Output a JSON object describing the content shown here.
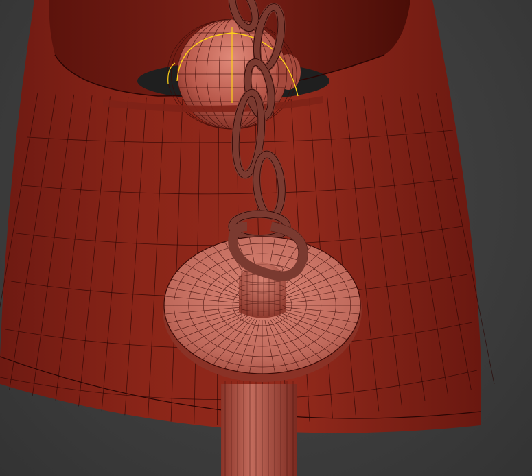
{
  "viewport": {
    "mode": "wireframe-on-shaded",
    "background_color": "#3d3d3d"
  },
  "colors": {
    "shade_outer": "#7a1f15",
    "shade_mid": "#8c261a",
    "shade_inner": "#4f0e08",
    "wire": "#2a0503",
    "body_light": "#d07466",
    "body_mid": "#b3574a",
    "body_dark": "#7d2c22",
    "chain": "#7a3a30",
    "selection": "#ffd21a"
  },
  "objects": [
    {
      "name": "lamp-shade",
      "icon": "cone-icon"
    },
    {
      "name": "bulb-sphere",
      "icon": "sphere-icon",
      "selected": true
    },
    {
      "name": "chain-links",
      "icon": "chain-icon"
    },
    {
      "name": "canopy-disc",
      "icon": "disc-icon"
    },
    {
      "name": "stem-pole",
      "icon": "cylinder-icon"
    }
  ]
}
